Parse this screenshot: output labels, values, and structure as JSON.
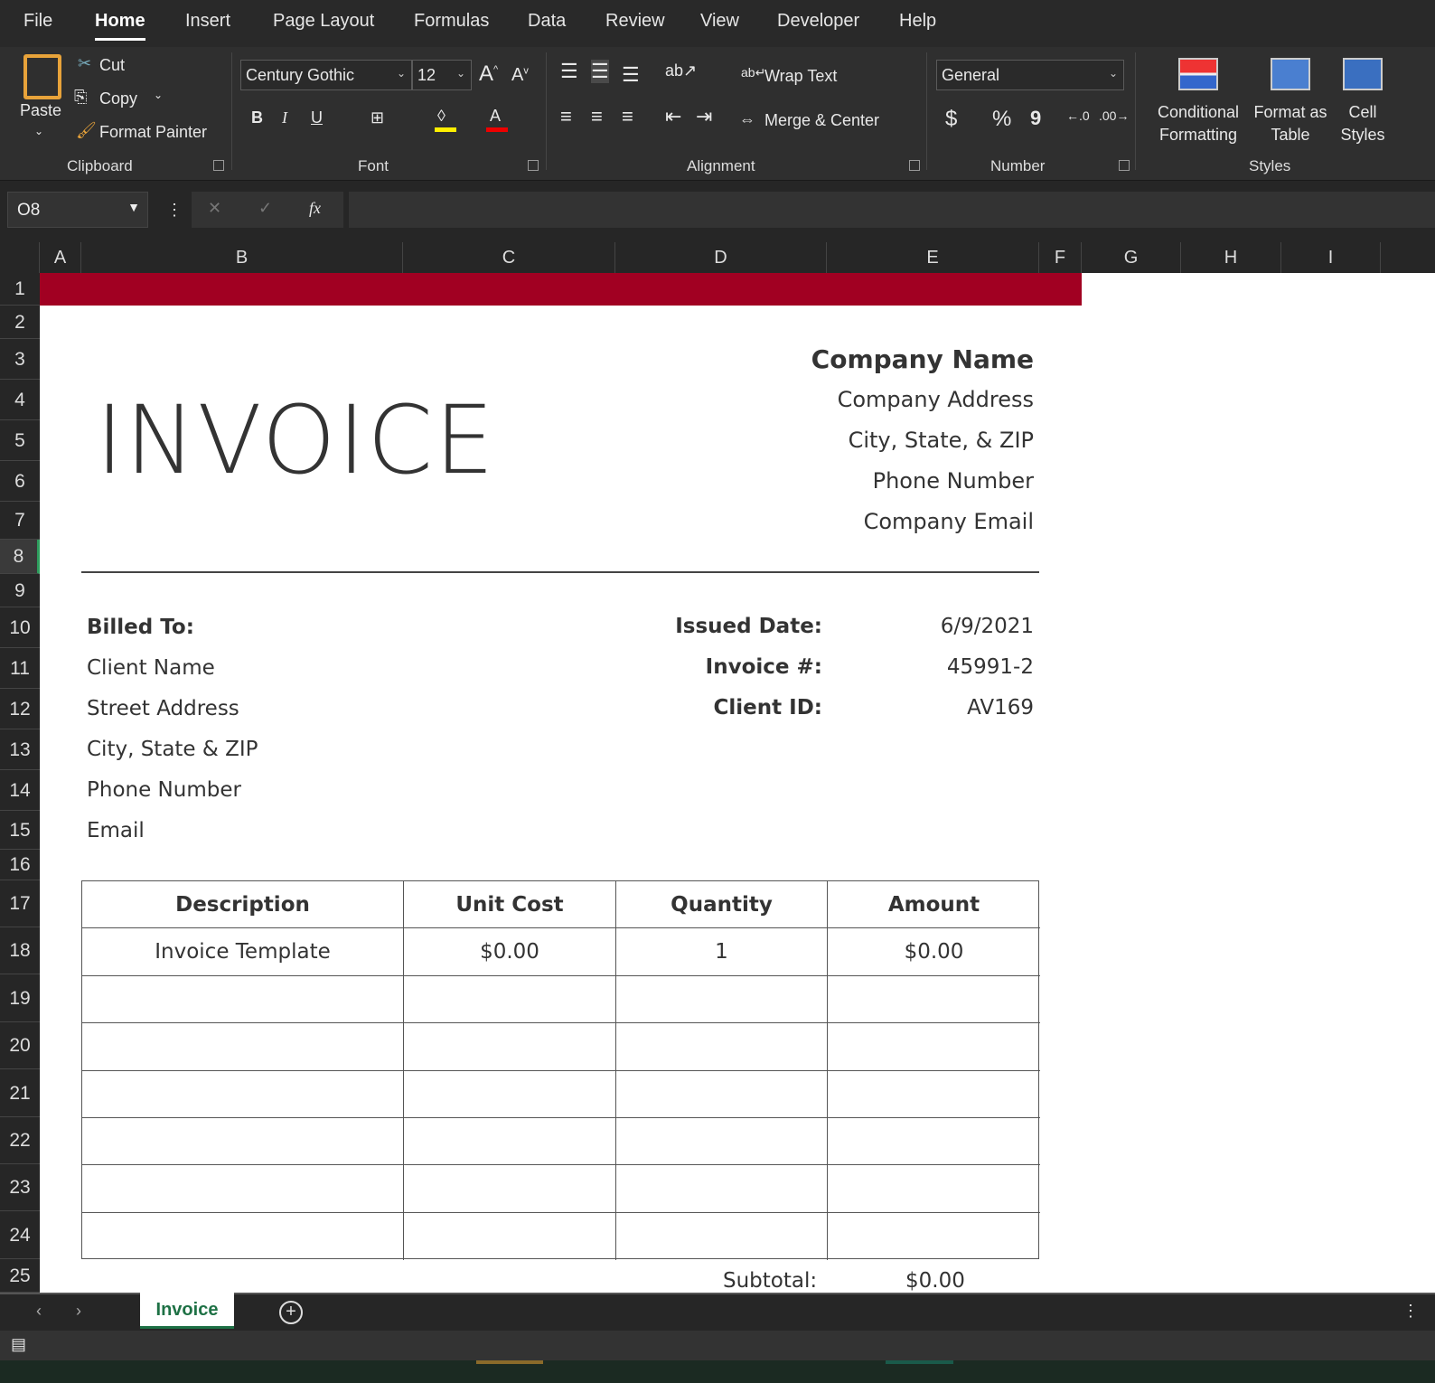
{
  "menu_tabs": [
    "File",
    "Home",
    "Insert",
    "Page Layout",
    "Formulas",
    "Data",
    "Review",
    "View",
    "Developer",
    "Help"
  ],
  "ribbon": {
    "clipboard": {
      "paste": "Paste",
      "cut": "Cut",
      "copy": "Copy",
      "format_painter": "Format Painter",
      "label": "Clipboard"
    },
    "font": {
      "name": "Century Gothic",
      "size": "12",
      "bold": "B",
      "italic": "I",
      "underline": "U",
      "label": "Font"
    },
    "alignment": {
      "wrap": "Wrap Text",
      "merge": "Merge & Center",
      "label": "Alignment"
    },
    "number": {
      "format": "General",
      "currency": "$",
      "percent": "%",
      "comma": "9",
      "label": "Number"
    },
    "styles": {
      "cond1": "Conditional",
      "cond2": "Formatting",
      "fmt1": "Format as",
      "fmt2": "Table",
      "cell1": "Cell",
      "cell2": "Styles",
      "label": "Styles"
    }
  },
  "formula_bar": {
    "name_box": "O8",
    "fx": "fx",
    "value": ""
  },
  "columns": [
    "A",
    "B",
    "C",
    "D",
    "E",
    "F",
    "G",
    "H",
    "I"
  ],
  "rows": [
    "1",
    "2",
    "3",
    "4",
    "5",
    "6",
    "7",
    "8",
    "9",
    "10",
    "11",
    "12",
    "13",
    "14",
    "15",
    "16",
    "17",
    "18",
    "19",
    "20",
    "21",
    "22",
    "23",
    "24",
    "25"
  ],
  "invoice": {
    "title": "INVOICE",
    "company": [
      "Company Name",
      "Company Address",
      "City, State, & ZIP",
      "Phone Number",
      "Company Email"
    ],
    "billed_to_label": "Billed To:",
    "client": [
      "Client Name",
      "Street Address",
      "City, State & ZIP",
      "Phone Number",
      "Email"
    ],
    "meta": [
      {
        "label": "Issued Date:",
        "value": "6/9/2021"
      },
      {
        "label": "Invoice #:",
        "value": "45991-2"
      },
      {
        "label": "Client ID:",
        "value": "AV169"
      }
    ],
    "table_headers": [
      "Description",
      "Unit Cost",
      "Quantity",
      "Amount"
    ],
    "items": [
      [
        "Invoice Template",
        "$0.00",
        "1",
        "$0.00"
      ]
    ],
    "subtotal_label": "Subtotal:",
    "subtotal": "$0.00",
    "accent": "#a10022"
  },
  "sheet_tabs": [
    "Invoice"
  ]
}
